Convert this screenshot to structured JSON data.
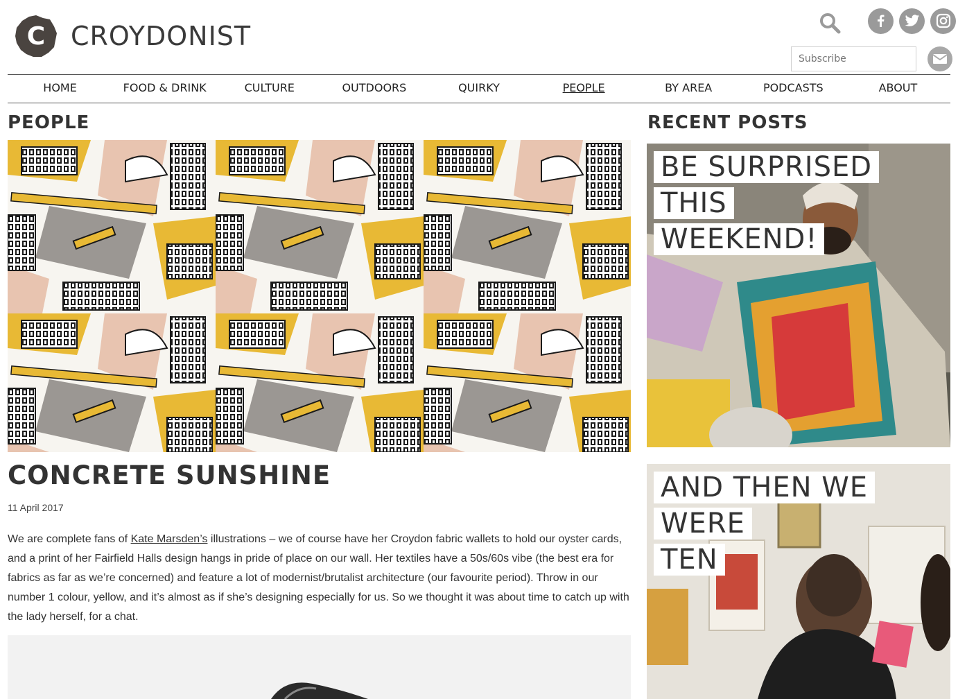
{
  "site": {
    "name": "CROYDONIST",
    "logo_letter": "C"
  },
  "header": {
    "icons": [
      "search-icon",
      "facebook-icon",
      "twitter-icon",
      "instagram-icon"
    ],
    "subscribe_placeholder": "Subscribe",
    "mail_icon": "mail-icon"
  },
  "nav": {
    "items": [
      {
        "label": "HOME"
      },
      {
        "label": "FOOD & DRINK"
      },
      {
        "label": "CULTURE"
      },
      {
        "label": "OUTDOORS"
      },
      {
        "label": "QUIRKY"
      },
      {
        "label": "PEOPLE",
        "active": true
      },
      {
        "label": "BY AREA"
      },
      {
        "label": "PODCASTS"
      },
      {
        "label": "ABOUT"
      }
    ]
  },
  "main": {
    "section_title": "PEOPLE",
    "article": {
      "title": "CONCRETE SUNSHINE",
      "date": "11 April 2017",
      "intro_before_link": "We are complete fans of ",
      "link_text": "Kate Marsden’s",
      "intro_after_link": " illustrations – we of course have her Croydon fabric wallets to hold our oyster cards, and a print of her Fairfield Halls design hangs in pride of place on our wall. Her textiles have a 50s/60s vibe (the best era for fabrics as far as we’re concerned) and feature a lot of modernist/brutalist architecture (our favourite period). Throw in our number 1 colour, yellow, and it’s almost as if she’s designing especially for us. So we thought it was about time to catch up with the lady herself, for a chat."
    }
  },
  "sidebar": {
    "title": "RECENT POSTS",
    "posts": [
      {
        "title_line1": "BE SURPRISED THIS",
        "title_line2": "WEEKEND!"
      },
      {
        "title_line1": "AND THEN WE WERE",
        "title_line2": "TEN"
      }
    ]
  },
  "colors": {
    "accent_yellow": "#e8b935",
    "pink": "#e8c4b0",
    "grey": "#9b9793",
    "text": "#333333"
  }
}
